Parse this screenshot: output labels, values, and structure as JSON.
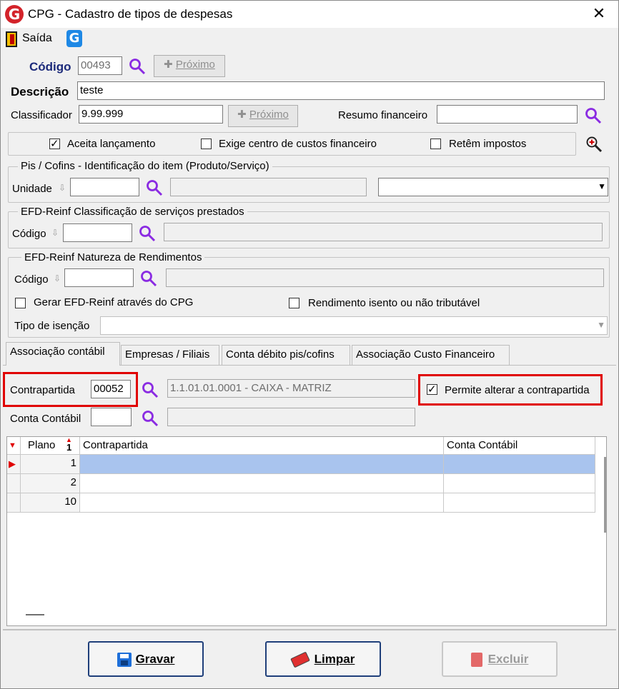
{
  "window": {
    "title": "CPG - Cadastro de tipos de despesas"
  },
  "toolbar": {
    "exit_label": "Saída"
  },
  "codigo": {
    "label": "Código",
    "value": "00493",
    "next_label": "Próximo"
  },
  "descricao": {
    "label": "Descrição",
    "value": "teste"
  },
  "classificador": {
    "label": "Classificador",
    "value": "9.99.999",
    "next_label": "Próximo"
  },
  "resumo": {
    "label": "Resumo financeiro",
    "value": ""
  },
  "options": {
    "aceita": {
      "label": "Aceita lançamento",
      "checked": true
    },
    "exige": {
      "label": "Exige centro de custos financeiro",
      "checked": false
    },
    "retem": {
      "label": "Retêm impostos",
      "checked": false
    }
  },
  "pis_group": {
    "title": "Pis / Cofins - Identificação do item (Produto/Serviço)",
    "unidade_label": "Unidade"
  },
  "efd_servicos": {
    "title": "EFD-Reinf Classificação de serviços prestados",
    "codigo_label": "Código"
  },
  "efd_natureza": {
    "title": "EFD-Reinf Natureza de Rendimentos",
    "codigo_label": "Código",
    "gerar_label": "Gerar EFD-Reinf através do CPG",
    "rendimento_label": "Rendimento isento ou não tributável",
    "tipo_label": "Tipo de isenção"
  },
  "tabs": [
    "Associação contábil",
    "Empresas / Filiais",
    "Conta débito pis/cofins",
    "Associação Custo Financeiro"
  ],
  "assoc": {
    "contrapartida_label": "Contrapartida",
    "contrapartida_value": "00052",
    "contrapartida_desc": "1.1.01.01.0001 - CAIXA - MATRIZ",
    "permite_label": "Permite alterar a contrapartida",
    "permite_checked": true,
    "conta_label": "Conta Contábil"
  },
  "grid": {
    "columns": [
      "Plano",
      "Contrapartida",
      "Conta Contábil"
    ],
    "sort_indicator": "1",
    "rows": [
      {
        "plano": "1",
        "contrapartida": "",
        "conta": ""
      },
      {
        "plano": "2",
        "contrapartida": "",
        "conta": ""
      },
      {
        "plano": "10",
        "contrapartida": "",
        "conta": ""
      }
    ]
  },
  "buttons": {
    "gravar": "Gravar",
    "limpar": "Limpar",
    "excluir": "Excluir"
  },
  "colors": {
    "accent_red": "#e00000",
    "selected_row": "#a9c4ee",
    "search_icon": "#8a2be2"
  }
}
